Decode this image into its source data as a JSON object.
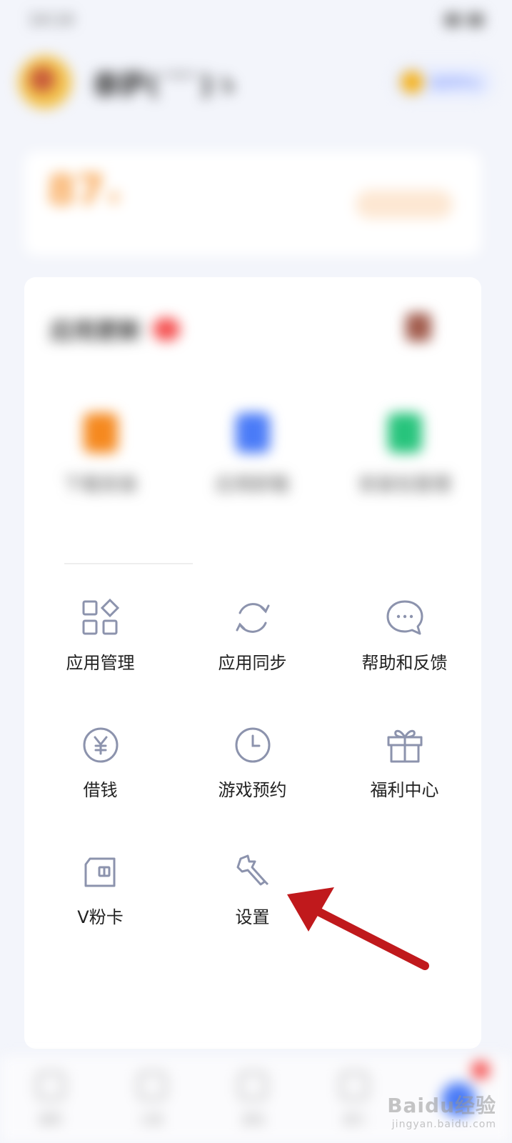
{
  "status_bar": {
    "left": "14:14",
    "right": ""
  },
  "profile": {
    "name": "泰萨(ˊˇˋ)ゝ",
    "member_text": "会员中心"
  },
  "score": {
    "value": "87",
    "unit": "+",
    "subtitle": "",
    "button": ""
  },
  "updates": {
    "title": "应用更新",
    "quick_actions": [
      {
        "label": "下载安装",
        "color": "#f5891f"
      },
      {
        "label": "应用卸载",
        "color": "#4a7bf7"
      },
      {
        "label": "安装包管理",
        "color": "#27c47c"
      }
    ]
  },
  "tools": [
    {
      "label": "应用管理",
      "icon": "grid-apps-icon"
    },
    {
      "label": "应用同步",
      "icon": "sync-icon"
    },
    {
      "label": "帮助和反馈",
      "icon": "chat-bubble-icon"
    },
    {
      "label": "借钱",
      "icon": "yuan-coin-icon"
    },
    {
      "label": "游戏预约",
      "icon": "clock-icon"
    },
    {
      "label": "福利中心",
      "icon": "gift-icon"
    },
    {
      "label": "V粉卡",
      "icon": "sim-card-icon"
    },
    {
      "label": "设置",
      "icon": "wrench-icon"
    }
  ],
  "bottom_nav": [
    {
      "label": "推荐"
    },
    {
      "label": "分类"
    },
    {
      "label": "游戏"
    },
    {
      "label": "排行"
    }
  ],
  "annotation": {
    "arrow_color": "#c0191c",
    "target": "设置"
  },
  "watermark": {
    "brand": "Baidu经验",
    "url": "jingyan.baidu.com"
  }
}
